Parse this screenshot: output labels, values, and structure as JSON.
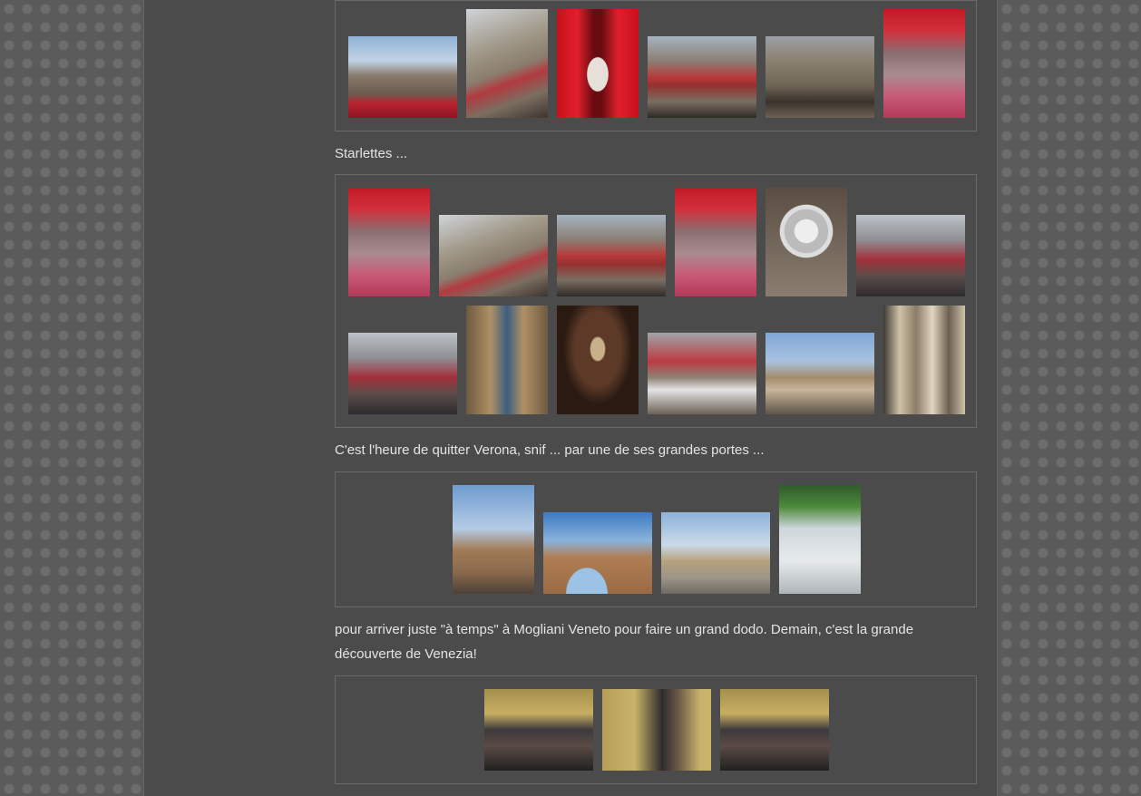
{
  "captions": {
    "starlettes": "Starlettes ...",
    "quitter": "C'est l'heure de quitter Verona, snif ... par une de ses grandes portes ...",
    "arriver": "pour arriver juste \"à temps\" à Mogliani Veneto pour faire un grand dodo. Demain, c'est la grande découverte de Venezia!"
  }
}
